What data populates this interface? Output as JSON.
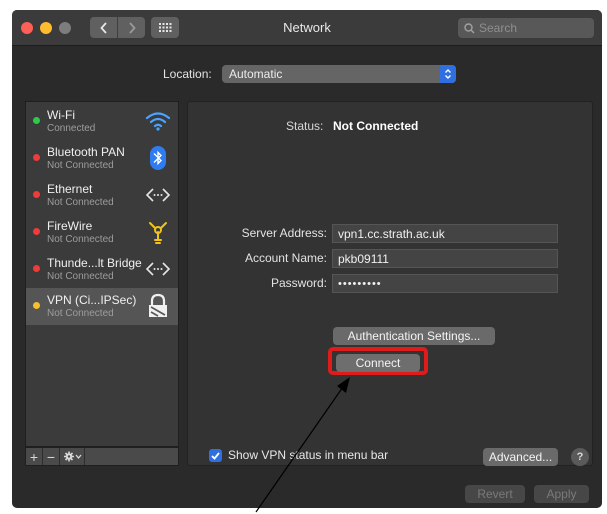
{
  "window": {
    "title": "Network",
    "search_placeholder": "Search"
  },
  "location": {
    "label": "Location:",
    "value": "Automatic"
  },
  "services": [
    {
      "name": "Wi-Fi",
      "status": "Connected",
      "dot_color": "#2fc84a",
      "icon": "wifi-icon"
    },
    {
      "name": "Bluetooth PAN",
      "status": "Not Connected",
      "dot_color": "#f03b3b",
      "icon": "bluetooth-icon"
    },
    {
      "name": "Ethernet",
      "status": "Not Connected",
      "dot_color": "#f03b3b",
      "icon": "ethernet-icon"
    },
    {
      "name": "FireWire",
      "status": "Not Connected",
      "dot_color": "#f03b3b",
      "icon": "firewire-icon"
    },
    {
      "name": "Thunde...lt Bridge",
      "status": "Not Connected",
      "dot_color": "#f03b3b",
      "icon": "thunderbolt-bridge-icon"
    },
    {
      "name": "VPN (Ci...IPSec)",
      "status": "Not Connected",
      "dot_color": "#f5c02c",
      "icon": "vpn-lock-icon",
      "selected": true
    }
  ],
  "sidebar_tools": {
    "add": "+",
    "remove": "−"
  },
  "detail": {
    "status_label": "Status:",
    "status_value": "Not Connected",
    "server_address_label": "Server Address:",
    "server_address_value": "vpn1.cc.strath.ac.uk",
    "account_name_label": "Account Name:",
    "account_name_value": "pkb09111",
    "password_label": "Password:",
    "password_value": "•••••••••",
    "auth_settings_button": "Authentication Settings...",
    "connect_button": "Connect",
    "show_vpn_status_label": "Show VPN status in menu bar",
    "show_vpn_status_checked": true,
    "advanced_button": "Advanced...",
    "help_button": "?"
  },
  "footer": {
    "revert_button": "Revert",
    "apply_button": "Apply"
  },
  "colors": {
    "accent": "#2f6fe0",
    "highlight": "#e01b1b"
  }
}
